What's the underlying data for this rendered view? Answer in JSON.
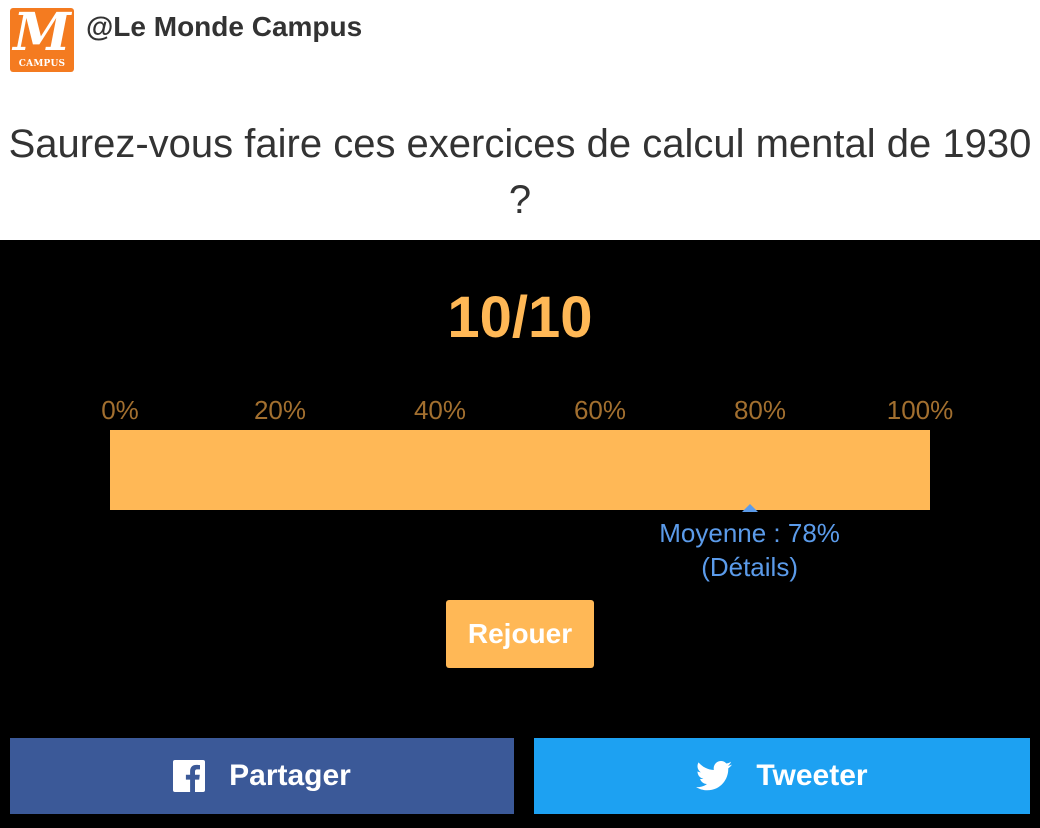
{
  "header": {
    "logo": {
      "letter": "M",
      "sub": "CAMPUS",
      "color": "#f47b20"
    },
    "account_name": "@Le Monde Campus",
    "title": "Saurez-vous faire ces exercices de calcul mental de 1930 ?"
  },
  "result": {
    "score": "10/10",
    "score_percent": 100,
    "scale_ticks": [
      "0%",
      "20%",
      "40%",
      "60%",
      "80%",
      "100%"
    ],
    "average_percent": 78,
    "average_label": "Moyenne : 78%",
    "details_link": "(Détails)",
    "replay_label": "Rejouer"
  },
  "share": {
    "facebook_label": "Partager",
    "facebook_icon": "facebook-icon",
    "twitter_label": "Tweeter",
    "twitter_icon": "twitter-icon"
  },
  "colors": {
    "accent": "#ffb856",
    "tick_text": "#a26f2f",
    "average": "#5b9bea",
    "facebook": "#3b5998",
    "twitter": "#1da1f2",
    "panel_bg": "#000000"
  }
}
